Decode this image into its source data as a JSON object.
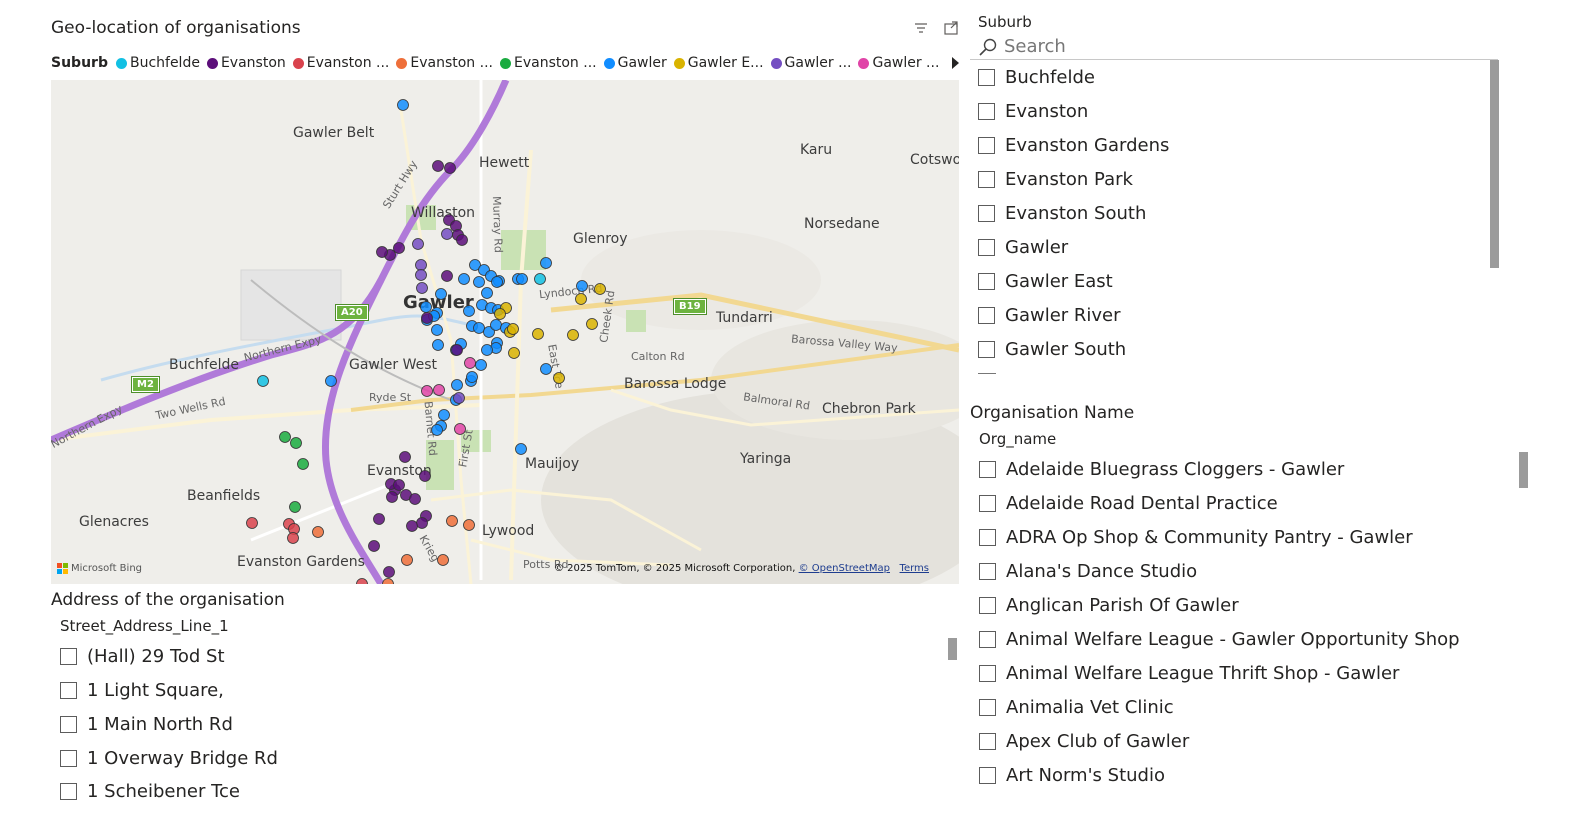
{
  "map_visual": {
    "title": "Geo-location of organisations",
    "legend_title": "Suburb",
    "legend_items": [
      {
        "label": "Buchfelde",
        "color": "#12c0e3"
      },
      {
        "label": "Evanston",
        "color": "#5c0e7a"
      },
      {
        "label": "Evanston ...",
        "color": "#d9434d"
      },
      {
        "label": "Evanston ...",
        "color": "#ee6f3a"
      },
      {
        "label": "Evanston ...",
        "color": "#1aab40"
      },
      {
        "label": "Gawler",
        "color": "#118dff"
      },
      {
        "label": "Gawler E...",
        "color": "#d9b300"
      },
      {
        "label": "Gawler ...",
        "color": "#744ec2"
      },
      {
        "label": "Gawler ...",
        "color": "#e044a7"
      }
    ],
    "header_icons": [
      "filter-icon",
      "focus-mode-icon"
    ],
    "place_labels": {
      "gawler_belt": "Gawler Belt",
      "hewett": "Hewett",
      "karu": "Karu",
      "cotswold": "Cotswo",
      "willaston": "Willaston",
      "glenroy": "Glenroy",
      "norsedane": "Norsedane",
      "gawler": "Gawler",
      "tundarri": "Tundarri",
      "buchfelde": "Buchfelde",
      "gawler_west": "Gawler West",
      "barossa_lodge": "Barossa Lodge",
      "chebron_park": "Chebron Park",
      "yaringa": "Yaringa",
      "mauijoy": "Mauijoy",
      "evanston": "Evanston",
      "beanfields": "Beanfields",
      "glenacres": "Glenacres",
      "lywood": "Lywood",
      "evanston_gardens": "Evanston Gardens"
    },
    "road_labels": {
      "sturt_hwy": "Sturt Hwy",
      "murray_rd": "Murray Rd",
      "northern_expy": "Northern Expy",
      "northern_expy_w": "Northern Expy",
      "lyndoch_rd": "Lyndoch Rd",
      "barossa_valley_way": "Barossa Valley Way",
      "two_wells_rd": "Two Wells Rd",
      "ryde_st": "Ryde St",
      "calton_rd": "Calton Rd",
      "balmoral_rd": "Balmoral Rd",
      "potts_rd": "Potts Rd",
      "first_st": "First St",
      "barnet_rd": "Barnet Rd",
      "east_tce": "East Tce",
      "cheek_rd": "Cheek Rd",
      "krieg": "Krieg"
    },
    "shields": {
      "a20": "A20",
      "b19": "B19",
      "m2": "M2"
    },
    "attribution": {
      "bing": "Microsoft Bing",
      "copyright": "© 2025 TomTom, © 2025 Microsoft Corporation, ",
      "osm_link": "© OpenStreetMap",
      "terms_link": "Terms"
    }
  },
  "address_slicer": {
    "title": "Address of the organisation",
    "header": "Street_Address_Line_1",
    "items": [
      "(Hall) 29 Tod St",
      "1 Light Square,",
      "1 Main North Rd",
      "1 Overway Bridge Rd",
      "1 Scheibener Tce"
    ]
  },
  "suburb_slicer": {
    "header": "Suburb",
    "search_placeholder": "Search",
    "items": [
      "Buchfelde",
      "Evanston",
      "Evanston Gardens",
      "Evanston Park",
      "Evanston South",
      "Gawler",
      "Gawler East",
      "Gawler River",
      "Gawler South"
    ]
  },
  "org_slicer": {
    "title": "Organisation Name",
    "header": "Org_name",
    "items": [
      "Adelaide Bluegrass Cloggers - Gawler",
      "Adelaide Road Dental Practice",
      "ADRA Op Shop & Community Pantry - Gawler",
      "Alana's Dance Studio",
      "Anglican Parish Of Gawler",
      "Animal Welfare League - Gawler Opportunity Shop",
      "Animal Welfare League Thrift Shop - Gawler",
      "Animalia Vet Clinic",
      "Apex Club of Gawler",
      "Art Norm's Studio"
    ]
  }
}
